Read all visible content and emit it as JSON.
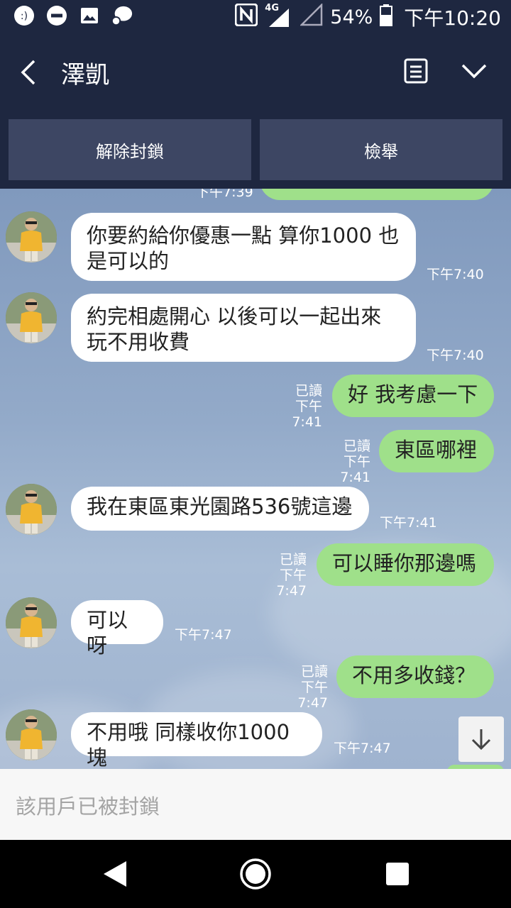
{
  "status_bar": {
    "network": "4G",
    "battery": "54%",
    "time": "下午10:20",
    "icons": [
      "line-icon",
      "minus-circle-icon",
      "image-icon",
      "chat-bubble-icon",
      "nfc-icon",
      "signal-icon",
      "signal-empty-icon",
      "battery-icon"
    ]
  },
  "header": {
    "title": "澤凱"
  },
  "block_bar": {
    "unblock_label": "解除封鎖",
    "report_label": "檢舉"
  },
  "messages": [
    {
      "side": "in",
      "text": "你要約給你優惠一點 算你1000 也是可以的",
      "time": "下午7:40"
    },
    {
      "side": "in",
      "text": "約完相處開心 以後可以一起出來玩不用收費",
      "time": "下午7:40"
    },
    {
      "side": "out",
      "text": "好 我考慮一下",
      "read": "已讀",
      "time": "下午7:41"
    },
    {
      "side": "out",
      "text": "東區哪裡",
      "read": "已讀",
      "time": "下午7:41"
    },
    {
      "side": "in",
      "text": "我在東區東光園路536號這邊",
      "time": "下午7:41"
    },
    {
      "side": "out",
      "text": "可以睡你那邊嗎",
      "read": "已讀",
      "time": "下午7:47"
    },
    {
      "side": "in",
      "text": "可以呀",
      "time": "下午7:47"
    },
    {
      "side": "out",
      "text": "不用多收錢？",
      "read": "已讀",
      "time": "下午7:47"
    },
    {
      "side": "in",
      "text": "不用哦 同樣收你1000塊",
      "time": "下午7:47"
    }
  ],
  "partial_top_time": "下午7:39",
  "input": {
    "blocked_text": "該用戶已被封鎖"
  },
  "colors": {
    "header_bg": "#1e2740",
    "button_bg": "#3d4663",
    "bubble_out": "#9fe08a",
    "bubble_in": "#ffffff"
  }
}
